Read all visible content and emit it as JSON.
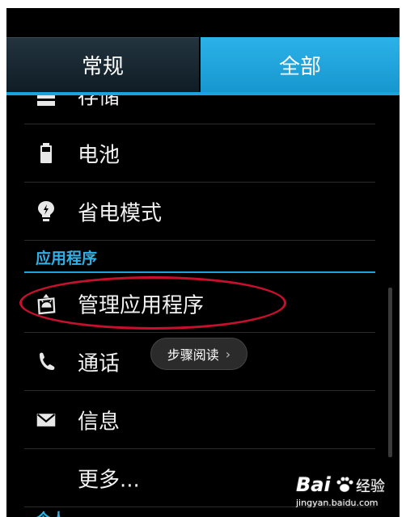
{
  "tabs": {
    "general": "常规",
    "all": "全部"
  },
  "items": {
    "storage": "存储",
    "battery": "电池",
    "power_saving": "省电模式",
    "manage_apps": "管理应用程序",
    "calls": "通话",
    "messages": "信息",
    "more": "更多..."
  },
  "sections": {
    "apps": "应用程序",
    "next": "个人"
  },
  "overlay": {
    "read_steps": "步骤阅读"
  },
  "watermark": {
    "brand": "Bai",
    "jingyan": "经验",
    "url": "jingyan.baidu.com"
  },
  "colors": {
    "accent": "#1aa3dd",
    "highlight": "#c8102e"
  },
  "icons": {
    "storage": "storage-icon",
    "battery": "battery-icon",
    "power_saving": "power-saving-icon",
    "manage_apps": "android-app-icon",
    "calls": "phone-icon",
    "messages": "envelope-icon"
  }
}
